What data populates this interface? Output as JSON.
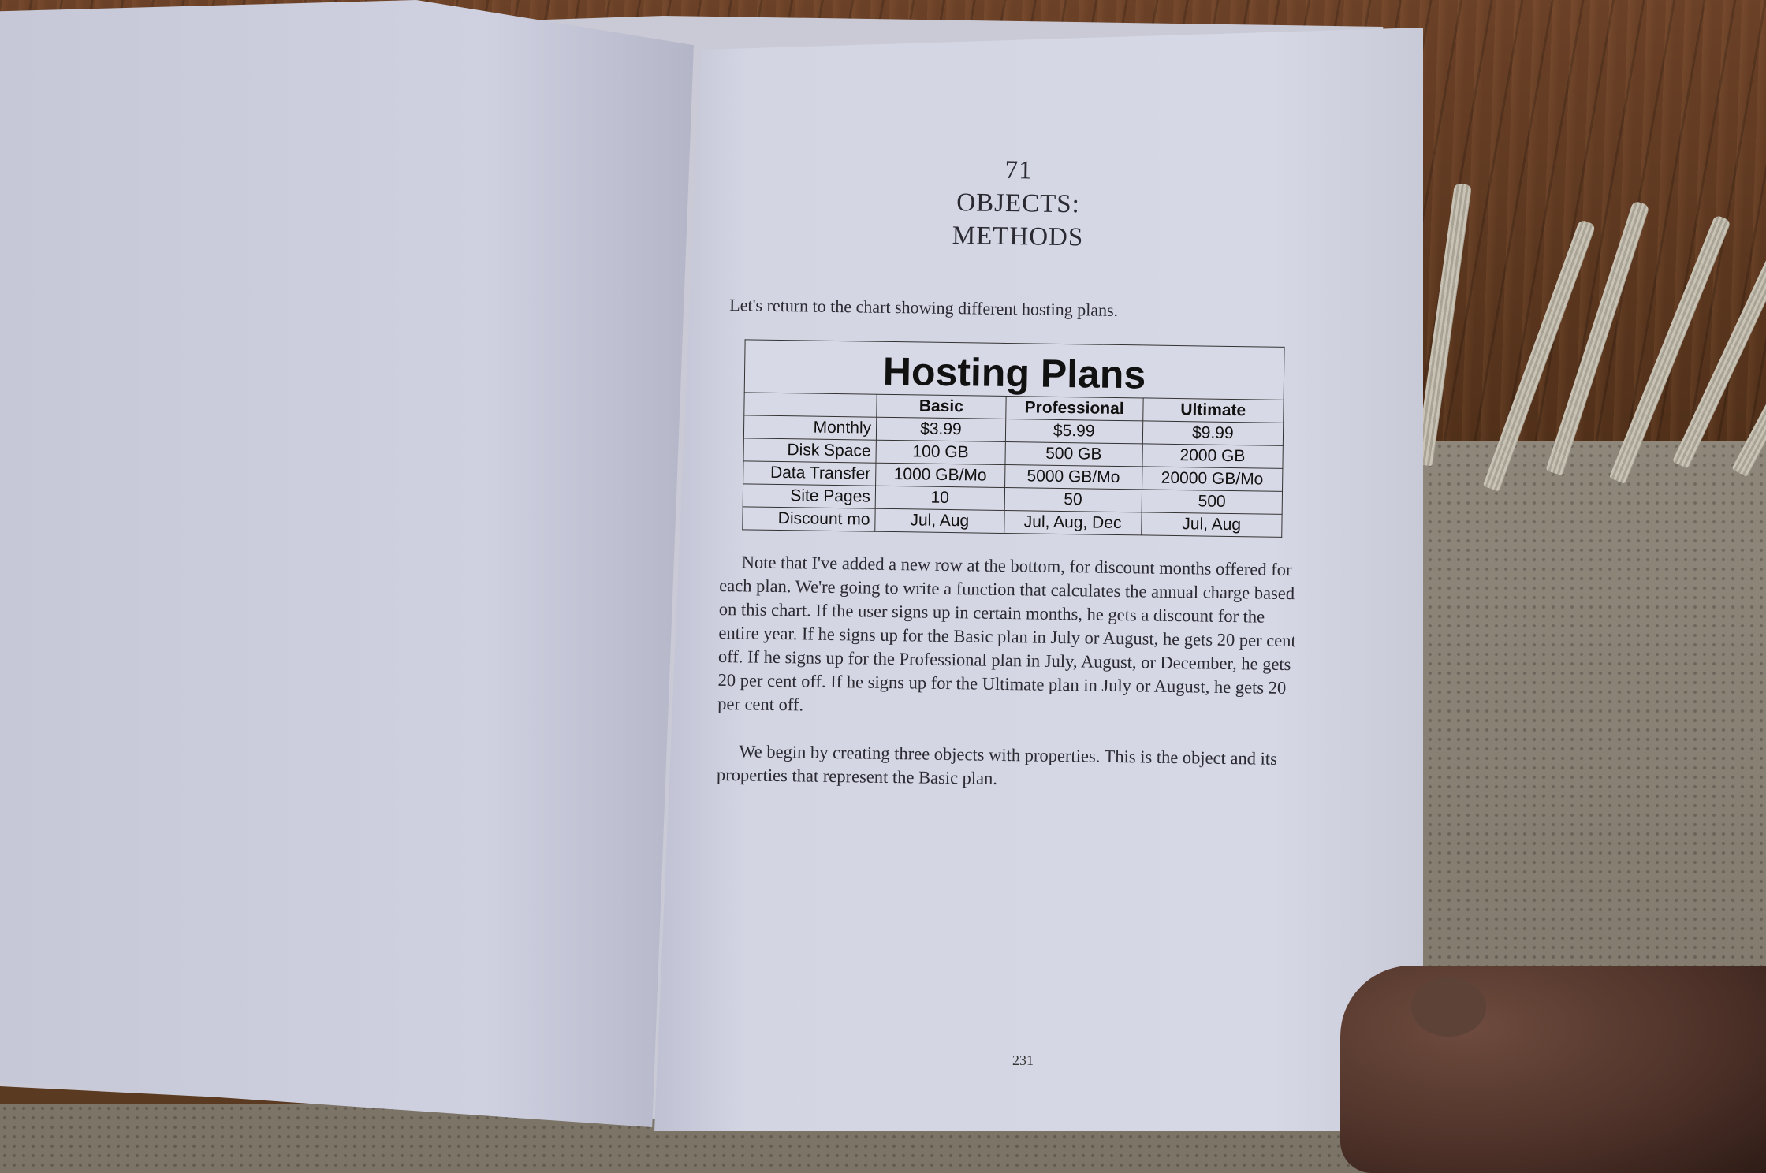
{
  "chapter": {
    "number": "71",
    "title_line1": "OBJECTS:",
    "title_line2": "METHODS"
  },
  "intro": "Let's return to the chart showing different hosting plans.",
  "table": {
    "title": "Hosting Plans",
    "columns": [
      "Basic",
      "Professional",
      "Ultimate"
    ],
    "rows": [
      {
        "label": "Monthly",
        "values": [
          "$3.99",
          "$5.99",
          "$9.99"
        ]
      },
      {
        "label": "Disk Space",
        "values": [
          "100 GB",
          "500 GB",
          "2000 GB"
        ]
      },
      {
        "label": "Data Transfer",
        "values": [
          "1000 GB/Mo",
          "5000 GB/Mo",
          "20000 GB/Mo"
        ]
      },
      {
        "label": "Site Pages",
        "values": [
          "10",
          "50",
          "500"
        ]
      },
      {
        "label": "Discount mo",
        "values": [
          "Jul, Aug",
          "Jul, Aug, Dec",
          "Jul, Aug"
        ]
      }
    ]
  },
  "paragraphs": [
    "Note that I've added a new row at the bottom, for discount months offered for each plan. We're going to write a function that calculates the annual charge based on this chart. If the user signs up in certain months, he gets a discount for the entire year. If he signs up for the Basic plan in July or August, he gets 20 per cent off. If he signs up for the Professional plan in July, August, or December, he gets 20 per cent off. If he signs up for the Ultimate plan in July or August, he gets 20 per cent off.",
    "We begin by creating three objects with properties. This is the object and its properties that represent the Basic plan."
  ],
  "page_number": "231"
}
